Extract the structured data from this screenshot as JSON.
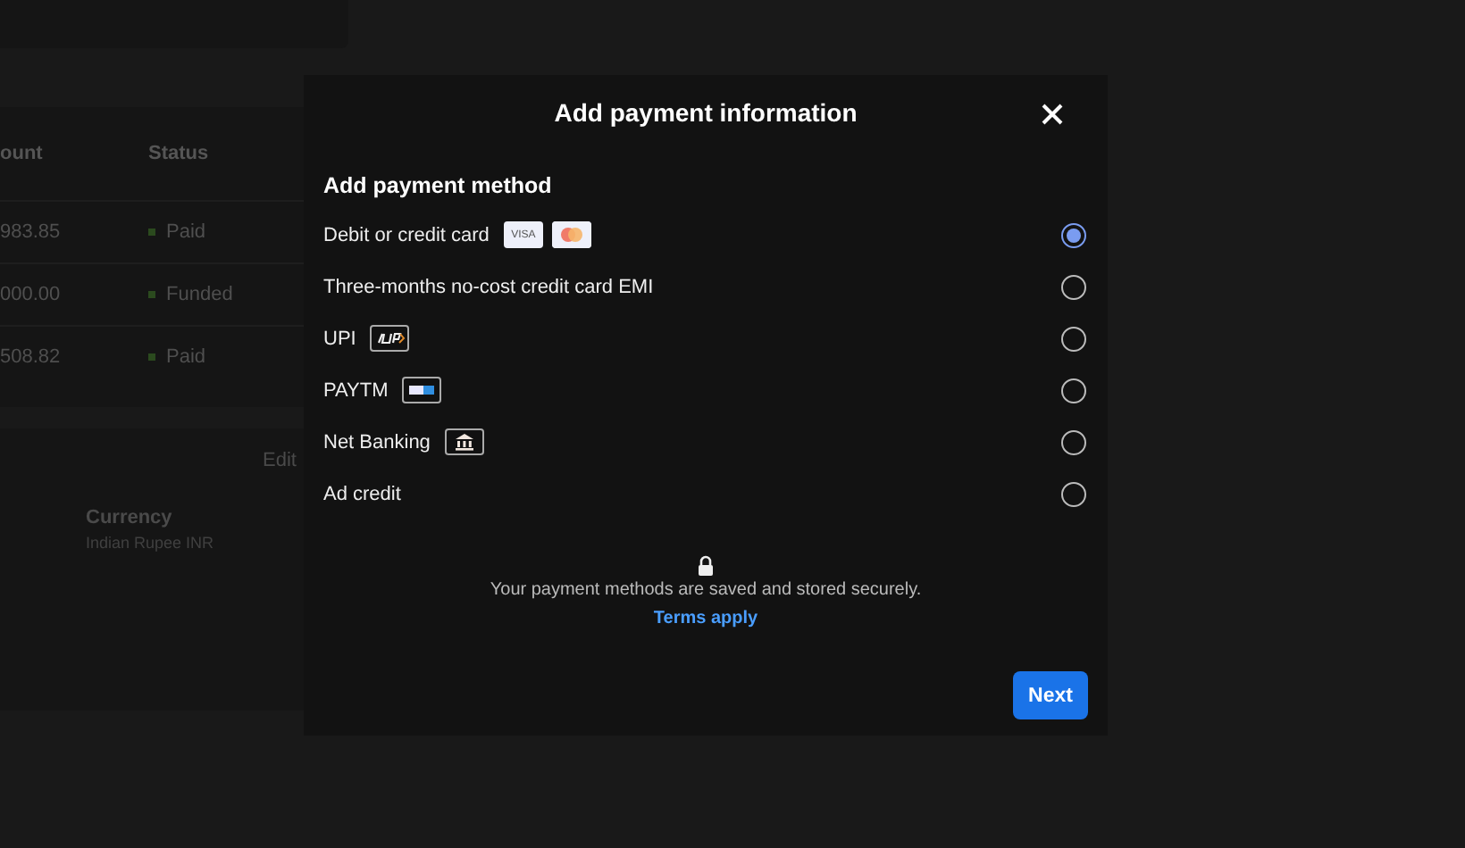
{
  "background": {
    "table": {
      "columns": [
        "ount",
        "Status"
      ],
      "rows": [
        {
          "amount": "983.85",
          "status": "Paid"
        },
        {
          "amount": "000.00",
          "status": "Funded"
        },
        {
          "amount": "508.82",
          "status": "Paid"
        }
      ]
    },
    "settings": {
      "edit": "Edit",
      "currency_label": "Currency",
      "currency_value": "Indian Rupee INR"
    }
  },
  "dialog": {
    "title": "Add payment information",
    "section": "Add payment method",
    "methods": [
      {
        "label": "Debit or credit card",
        "selected": true,
        "badges": [
          {
            "kind": "visa",
            "text": "VISA"
          },
          {
            "kind": "mastercard"
          }
        ]
      },
      {
        "label": "Three-months no-cost credit card EMI",
        "selected": false
      },
      {
        "label": "UPI",
        "selected": false,
        "badges": [
          {
            "kind": "upi"
          }
        ]
      },
      {
        "label": "PAYTM",
        "selected": false,
        "badges": [
          {
            "kind": "paytm"
          }
        ]
      },
      {
        "label": "Net Banking",
        "selected": false,
        "badges": [
          {
            "kind": "bank"
          }
        ]
      },
      {
        "label": "Ad credit",
        "selected": false
      }
    ],
    "note": "Your payment methods are saved and stored securely.",
    "link": "Terms apply",
    "next": "Next"
  }
}
